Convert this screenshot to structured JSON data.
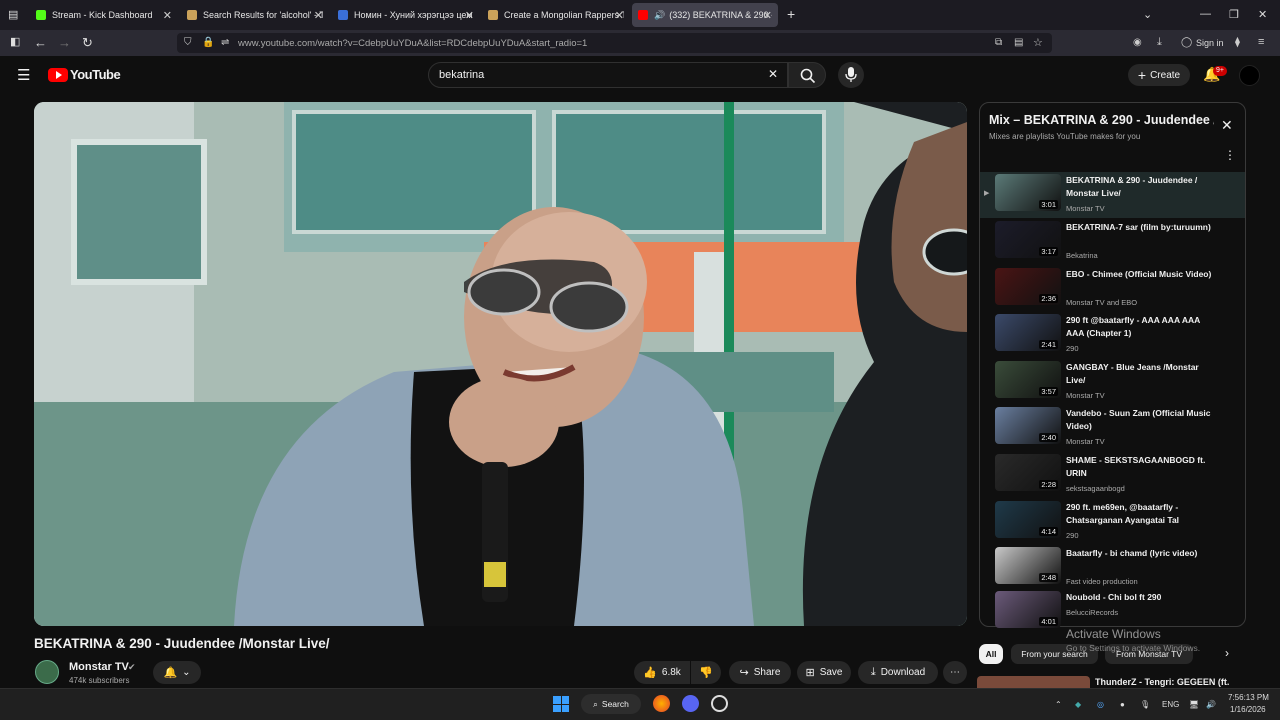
{
  "browser": {
    "tabs": [
      {
        "title": "Stream - Kick Dashboard",
        "color": "#53fc18"
      },
      {
        "title": "Search Results for 'alcohol' - Tir",
        "color": "#caa25a"
      },
      {
        "title": "Номин - Хуний хэрэгцээ цем б",
        "color": "#3a6fd8"
      },
      {
        "title": "Create a Mongolian Rappers Ti",
        "color": "#caa25a"
      },
      {
        "title": "(332) BEKATRINA & 290 - Ju",
        "color": "#ff0000"
      }
    ],
    "url": "www.youtube.com/watch?v=CdebpUuYDuA&list=RDCdebpUuYDuA&start_radio=1",
    "sign_in": "Sign in",
    "new_tab": "+"
  },
  "youtube": {
    "logo_text": "YouTube",
    "search_value": "bekatrina",
    "create_label": "Create",
    "notif_badge": "9+"
  },
  "video": {
    "title": "BEKATRINA & 290 - Juudendee /Monstar Live/",
    "channel": "Monstar TV",
    "subscribers": "474k subscribers",
    "likes": "6.8k",
    "share": "Share",
    "save": "Save",
    "download": "Download"
  },
  "playlist": {
    "title": "Mix – BEKATRINA & 290 - Juudendee /Monstar Live/",
    "subtitle": "Mixes are playlists YouTube makes for you",
    "items": [
      {
        "title": "BEKATRINA & 290 - Juudendee / Monstar Live/",
        "channel": "Monstar TV",
        "duration": "3:01",
        "thumb": "#5b7a78"
      },
      {
        "title": "BEKATRINA-7 sar (film by:turuumn)",
        "channel": "Bekatrina",
        "duration": "3:17",
        "thumb": "#1c1c2a"
      },
      {
        "title": "EBO - Chimee (Official Music Video)",
        "channel": "Monstar TV and EBO",
        "duration": "2:36",
        "thumb": "#4a1414"
      },
      {
        "title": "290 ft @baatarfly - AAA AAA AAA AAA (Chapter 1)",
        "channel": "290",
        "duration": "2:41",
        "thumb": "#3b4a6a"
      },
      {
        "title": "GANGBAY - Blue Jeans /Monstar Live/",
        "channel": "Monstar TV",
        "duration": "3:57",
        "thumb": "#3a4c3a"
      },
      {
        "title": "Vandebo - Suun Zam (Official Music Video)",
        "channel": "Monstar TV",
        "duration": "2:40",
        "thumb": "#6a7fa0"
      },
      {
        "title": "SHAME - SEKSTSAGAANBOGD ft. URIN",
        "channel": "sekstsagaanbogd",
        "duration": "2:28",
        "thumb": "#2a2a2a"
      },
      {
        "title": "290 ft. me69en, @baatarfly - Chatsarganan Ayangatai Tal",
        "channel": "290",
        "duration": "4:14",
        "thumb": "#1f3a4a"
      },
      {
        "title": "Baatarfly - bi chamd (lyric video)",
        "channel": "Fast video production",
        "duration": "2:48",
        "thumb": "#c9c9c9"
      },
      {
        "title": "Noubold - Chi bol ft 290",
        "channel": "BelucciRecords",
        "duration": "4:01",
        "thumb": "#6b5a7a"
      }
    ]
  },
  "chips": [
    "All",
    "From your search",
    "From Monstar TV"
  ],
  "next_video": "ThunderZ - Tengri: GEGEEN (ft.",
  "windows": {
    "activate_title": "Activate Windows",
    "activate_sub": "Go to Settings to activate Windows.",
    "search": "Search",
    "lang": "ENG",
    "time": "7:56:13 PM",
    "date": "1/16/2026"
  }
}
